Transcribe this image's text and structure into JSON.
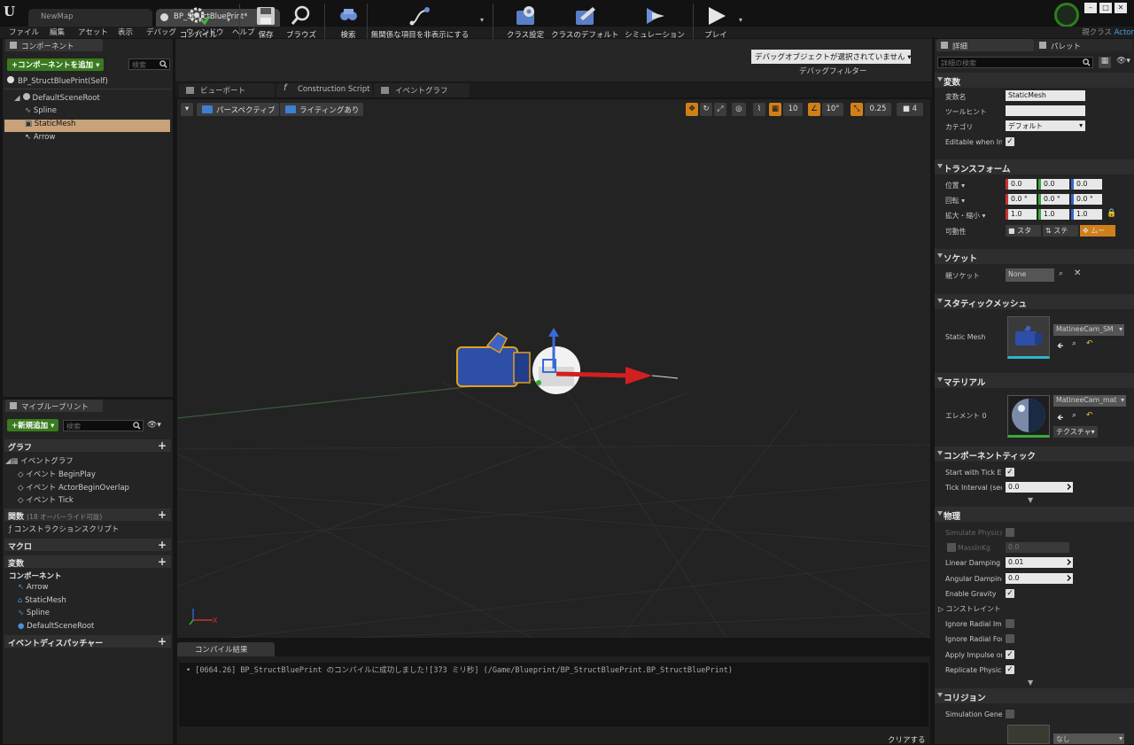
{
  "titlebar": {
    "tabs": [
      {
        "label": "NewMap"
      },
      {
        "label": "BP_StructBluePrint*"
      }
    ],
    "win_min": "–",
    "win_max": "□",
    "win_close": "✕"
  },
  "menu": [
    "ファイル",
    "編集",
    "アセット",
    "表示",
    "デバッグ",
    "ウィンドウ",
    "ヘルプ"
  ],
  "parent_class": {
    "label": "親クラス",
    "value": "Actor"
  },
  "components_panel": {
    "title": "コンポーネント",
    "add_button": "+コンポーネントを追加 ▾",
    "search_placeholder": "検索",
    "self": "BP_StructBluePrint(Self)",
    "tree": [
      "DefaultSceneRoot",
      "Spline",
      "StaticMesh",
      "Arrow"
    ],
    "selected": "StaticMesh"
  },
  "myblueprint": {
    "title": "マイブループリント",
    "add_button": "+新規追加 ▾",
    "search_placeholder": "検索",
    "graph_section": "グラフ",
    "event_graph": "イベントグラフ",
    "events": [
      "イベント BeginPlay",
      "イベント ActorBeginOverlap",
      "イベント Tick"
    ],
    "functions_section": "関数",
    "functions_note": "(18 オーバーライド可能)",
    "construction_script": "コンストラクションスクリプト",
    "macros_section": "マクロ",
    "variables_section": "変数",
    "components_section": "コンポーネント",
    "component_items": [
      "Arrow",
      "StaticMesh",
      "Spline",
      "DefaultSceneRoot"
    ],
    "dispatchers_section": "イベントディスパッチャー"
  },
  "toolbar": {
    "buttons": [
      {
        "label": "コンパイル",
        "icon": "compile-icon"
      },
      {
        "label": "保存",
        "icon": "save-icon"
      },
      {
        "label": "ブラウズ",
        "icon": "browse-icon"
      },
      {
        "label": "検索",
        "icon": "find-icon"
      },
      {
        "label": "無関係な項目を非表示にする",
        "icon": "hide-unrelated-icon"
      },
      {
        "label": "クラス設定",
        "icon": "class-settings-icon"
      },
      {
        "label": "クラスのデフォルト",
        "icon": "class-defaults-icon"
      },
      {
        "label": "シミュレーション",
        "icon": "simulation-icon"
      },
      {
        "label": "プレイ",
        "icon": "play-icon"
      }
    ],
    "debug_select": "デバッグオブジェクトが選択されていません ▾",
    "debug_filter": "デバッグフィルター"
  },
  "editor_tabs": [
    "ビューポート",
    "Construction Script",
    "イベントグラフ"
  ],
  "viewport": {
    "perspective": "パースペクティブ",
    "lighting": "ライティングあり",
    "grid_snap": "10",
    "rot_snap": "10°",
    "scale_snap": "0.25",
    "cam_speed": "4"
  },
  "compile_results": {
    "tab": "コンパイル結果",
    "log": "• [0664.26] BP_StructBluePrint のコンパイルに成功しました![373 ミリ秒] (/Game/Blueprint/BP_StructBluePrint.BP_StructBluePrint)",
    "clear": "クリアする"
  },
  "details": {
    "tab_details": "詳細",
    "tab_palette": "パレット",
    "search_placeholder": "詳細の検索",
    "variables": {
      "title": "変数",
      "var_name_label": "変数名",
      "var_name": "StaticMesh",
      "tooltip_label": "ツールヒント",
      "tooltip": "",
      "category_label": "カテゴリ",
      "category": "デフォルト",
      "editable_label": "Editable when Inher"
    },
    "transform": {
      "title": "トランスフォーム",
      "location_label": "位置 ▾",
      "rotation_label": "回転 ▾",
      "scale_label": "拡大・縮小 ▾",
      "mobility_label": "可動性",
      "location": [
        "0.0",
        "0.0",
        "0.0"
      ],
      "rotation": [
        "0.0 °",
        "0.0 °",
        "0.0 °"
      ],
      "scale": [
        "1.0",
        "1.0",
        "1.0"
      ],
      "mobility": [
        "スタ",
        "ステ",
        "ムー"
      ]
    },
    "sockets": {
      "title": "ソケット",
      "parent_label": "親ソケット",
      "parent": "None"
    },
    "static_mesh": {
      "title": "スタティックメッシュ",
      "label": "Static Mesh",
      "value": "MatineeCam_SM"
    },
    "materials": {
      "title": "マテリアル",
      "element_label": "エレメント 0",
      "value": "MatineeCam_mat",
      "texture_btn": "テクスチャ▾"
    },
    "component_tick": {
      "title": "コンポーネントティック",
      "start_label": "Start with Tick Ena",
      "interval_label": "Tick Interval (secs)",
      "interval": "0.0"
    },
    "physics": {
      "title": "物理",
      "simulate_label": "Simulate Physics",
      "mass_label": "MassInKg",
      "mass": "0.0",
      "linear_label": "Linear Damping",
      "linear": "0.01",
      "angular_label": "Angular Damping",
      "angular": "0.0",
      "gravity_label": "Enable Gravity",
      "constraints_label": "コンストレイント",
      "radial_impulse_label": "Ignore Radial Impu",
      "radial_force_label": "Ignore Radial Forc",
      "apply_impulse_label": "Apply Impulse on D",
      "replicate_label": "Replicate Physics t"
    },
    "collision": {
      "title": "コリジョン",
      "sim_gen_label": "Simulation Genera",
      "preset": "なし"
    }
  }
}
